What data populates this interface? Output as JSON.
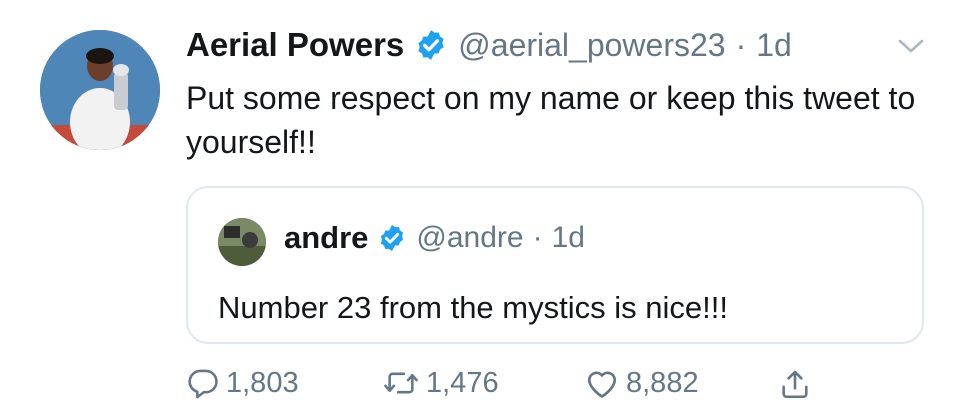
{
  "tweet": {
    "author_name": "Aerial Powers",
    "handle": "@aerial_powers23",
    "separator": "·",
    "time": "1d",
    "text": "Put some respect on my name or keep this tweet to yourself!!",
    "verified": true
  },
  "quoted_tweet": {
    "author_name": "andre",
    "handle": "@andre",
    "separator": "·",
    "time": "1d",
    "text": "Number 23 from the mystics is nice!!!",
    "verified": true
  },
  "actions": {
    "replies": "1,803",
    "retweets": "1,476",
    "likes": "8,882"
  },
  "colors": {
    "verified_blue": "#1da1f2",
    "secondary_text": "#657786",
    "border": "#e1e8ed"
  },
  "icons": {
    "reply": "reply-icon",
    "retweet": "retweet-icon",
    "like": "heart-icon",
    "share": "share-icon",
    "caret": "chevron-down-icon",
    "verified": "verified-badge-icon"
  }
}
